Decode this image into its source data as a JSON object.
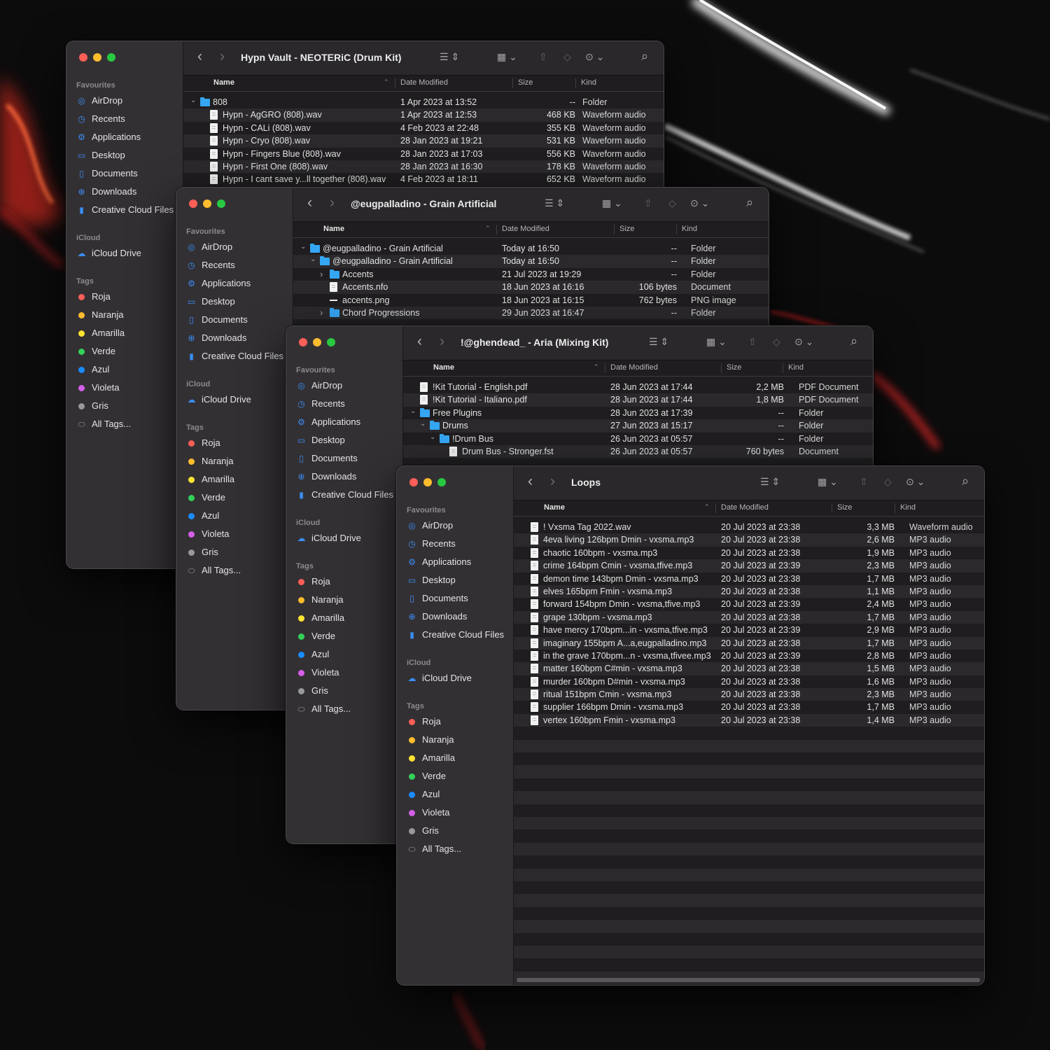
{
  "sidebar": {
    "favourites_title": "Favourites",
    "favourites": [
      {
        "label": "AirDrop",
        "icon": "airdrop-icon"
      },
      {
        "label": "Recents",
        "icon": "clock-icon"
      },
      {
        "label": "Applications",
        "icon": "applications-icon"
      },
      {
        "label": "Desktop",
        "icon": "desktop-icon"
      },
      {
        "label": "Documents",
        "icon": "document-icon"
      },
      {
        "label": "Downloads",
        "icon": "download-icon"
      },
      {
        "label": "Creative Cloud Files",
        "icon": "file-icon"
      }
    ],
    "icloud_title": "iCloud",
    "icloud": [
      {
        "label": "iCloud Drive",
        "icon": "cloud-icon"
      }
    ],
    "tags_title": "Tags",
    "tags": [
      {
        "label": "Roja",
        "color": "#fe5f57"
      },
      {
        "label": "Naranja",
        "color": "#febc2e"
      },
      {
        "label": "Amarilla",
        "color": "#ffe432"
      },
      {
        "label": "Verde",
        "color": "#32d158"
      },
      {
        "label": "Azul",
        "color": "#1a8cff"
      },
      {
        "label": "Violeta",
        "color": "#d45fe8"
      },
      {
        "label": "Gris",
        "color": "#98989d"
      }
    ],
    "all_tags": "All Tags..."
  },
  "columns": {
    "name": "Name",
    "date": "Date Modified",
    "size": "Size",
    "kind": "Kind"
  },
  "windows": [
    {
      "title": "Hypn Vault - NEOTERiC (Drum Kit)",
      "rows": [
        {
          "name": "808",
          "date": "1 Apr 2023 at 13:52",
          "size": "--",
          "kind": "Folder",
          "type": "folder",
          "depth": 0,
          "disclosure": "open"
        },
        {
          "name": "Hypn - AgGRO (808).wav",
          "date": "1 Apr 2023 at 12:53",
          "size": "468 KB",
          "kind": "Waveform audio",
          "type": "file",
          "depth": 1
        },
        {
          "name": "Hypn - CALi (808).wav",
          "date": "4 Feb 2023 at 22:48",
          "size": "355 KB",
          "kind": "Waveform audio",
          "type": "file",
          "depth": 1
        },
        {
          "name": "Hypn - Cryo (808).wav",
          "date": "28 Jan 2023 at 19:21",
          "size": "531 KB",
          "kind": "Waveform audio",
          "type": "file",
          "depth": 1
        },
        {
          "name": "Hypn - Fingers Blue (808).wav",
          "date": "28 Jan 2023 at 17:03",
          "size": "556 KB",
          "kind": "Waveform audio",
          "type": "file",
          "depth": 1
        },
        {
          "name": "Hypn - First One (808).wav",
          "date": "28 Jan 2023 at 16:30",
          "size": "178 KB",
          "kind": "Waveform audio",
          "type": "file",
          "depth": 1
        },
        {
          "name": "Hypn - I cant save y...ll together (808).wav",
          "date": "4 Feb 2023 at 18:11",
          "size": "652 KB",
          "kind": "Waveform audio",
          "type": "file",
          "depth": 1
        }
      ]
    },
    {
      "title": "@eugpalladino - Grain Artificial",
      "rows": [
        {
          "name": "@eugpalladino - Grain Artificial",
          "date": "Today at 16:50",
          "size": "--",
          "kind": "Folder",
          "type": "folder",
          "depth": 0,
          "disclosure": "open"
        },
        {
          "name": "@eugpalladino - Grain Artificial",
          "date": "Today at 16:50",
          "size": "--",
          "kind": "Folder",
          "type": "folder",
          "depth": 1,
          "disclosure": "open"
        },
        {
          "name": "Accents",
          "date": "21 Jul 2023 at 19:29",
          "size": "--",
          "kind": "Folder",
          "type": "folder",
          "depth": 2,
          "disclosure": "closed"
        },
        {
          "name": "Accents.nfo",
          "date": "18 Jun 2023 at 16:16",
          "size": "106 bytes",
          "kind": "Document",
          "type": "file",
          "depth": 2
        },
        {
          "name": "accents.png",
          "date": "18 Jun 2023 at 16:15",
          "size": "762 bytes",
          "kind": "PNG image",
          "type": "image",
          "depth": 2
        },
        {
          "name": "Chord Progressions",
          "date": "29 Jun 2023 at 16:47",
          "size": "--",
          "kind": "Folder",
          "type": "folder",
          "depth": 2,
          "disclosure": "closed"
        }
      ]
    },
    {
      "title": "!@ghendead_ - Aria (Mixing Kit)",
      "rows": [
        {
          "name": "!Kit Tutorial - English.pdf",
          "date": "28 Jun 2023 at 17:44",
          "size": "2,2 MB",
          "kind": "PDF Document",
          "type": "file",
          "depth": 0
        },
        {
          "name": "!Kit Tutorial - Italiano.pdf",
          "date": "28 Jun 2023 at 17:44",
          "size": "1,8 MB",
          "kind": "PDF Document",
          "type": "file",
          "depth": 0
        },
        {
          "name": "Free Plugins",
          "date": "28 Jun 2023 at 17:39",
          "size": "--",
          "kind": "Folder",
          "type": "folder",
          "depth": 0,
          "disclosure": "open"
        },
        {
          "name": "Drums",
          "date": "27 Jun 2023 at 15:17",
          "size": "--",
          "kind": "Folder",
          "type": "folder",
          "depth": 1,
          "disclosure": "open"
        },
        {
          "name": "!Drum Bus",
          "date": "26 Jun 2023 at 05:57",
          "size": "--",
          "kind": "Folder",
          "type": "folder",
          "depth": 2,
          "disclosure": "open"
        },
        {
          "name": "Drum Bus - Stronger.fst",
          "date": "26 Jun 2023 at 05:57",
          "size": "760 bytes",
          "kind": "Document",
          "type": "file",
          "depth": 3
        }
      ]
    },
    {
      "title": "Loops",
      "rows": [
        {
          "name": "! Vxsma Tag 2022.wav",
          "date": "20 Jul 2023 at 23:38",
          "size": "3,3 MB",
          "kind": "Waveform audio",
          "type": "file",
          "depth": 0
        },
        {
          "name": "4eva living 126bpm Dmin - vxsma.mp3",
          "date": "20 Jul 2023 at 23:38",
          "size": "2,6 MB",
          "kind": "MP3 audio",
          "type": "file",
          "depth": 0
        },
        {
          "name": "chaotic 160bpm - vxsma.mp3",
          "date": "20 Jul 2023 at 23:38",
          "size": "1,9 MB",
          "kind": "MP3 audio",
          "type": "file",
          "depth": 0
        },
        {
          "name": "crime 164bpm Cmin - vxsma,tfive.mp3",
          "date": "20 Jul 2023 at 23:39",
          "size": "2,3 MB",
          "kind": "MP3 audio",
          "type": "file",
          "depth": 0
        },
        {
          "name": "demon time 143bpm Dmin - vxsma.mp3",
          "date": "20 Jul 2023 at 23:38",
          "size": "1,7 MB",
          "kind": "MP3 audio",
          "type": "file",
          "depth": 0
        },
        {
          "name": "elves 165bpm Fmin - vxsma.mp3",
          "date": "20 Jul 2023 at 23:38",
          "size": "1,1 MB",
          "kind": "MP3 audio",
          "type": "file",
          "depth": 0
        },
        {
          "name": "forward 154bpm Dmin - vxsma,tfive.mp3",
          "date": "20 Jul 2023 at 23:39",
          "size": "2,4 MB",
          "kind": "MP3 audio",
          "type": "file",
          "depth": 0
        },
        {
          "name": "grape 130bpm - vxsma.mp3",
          "date": "20 Jul 2023 at 23:38",
          "size": "1,7 MB",
          "kind": "MP3 audio",
          "type": "file",
          "depth": 0
        },
        {
          "name": "have mercy 170bpm...in - vxsma,tfive.mp3",
          "date": "20 Jul 2023 at 23:39",
          "size": "2,9 MB",
          "kind": "MP3 audio",
          "type": "file",
          "depth": 0
        },
        {
          "name": "imaginary 155bpm A...a,eugpalladino.mp3",
          "date": "20 Jul 2023 at 23:38",
          "size": "1,7 MB",
          "kind": "MP3 audio",
          "type": "file",
          "depth": 0
        },
        {
          "name": "in the grave 170bpm...n - vxsma,tfivee.mp3",
          "date": "20 Jul 2023 at 23:39",
          "size": "2,8 MB",
          "kind": "MP3 audio",
          "type": "file",
          "depth": 0
        },
        {
          "name": "matter 160bpm C#min - vxsma.mp3",
          "date": "20 Jul 2023 at 23:38",
          "size": "1,5 MB",
          "kind": "MP3 audio",
          "type": "file",
          "depth": 0
        },
        {
          "name": "murder 160bpm D#min - vxsma.mp3",
          "date": "20 Jul 2023 at 23:38",
          "size": "1,6 MB",
          "kind": "MP3 audio",
          "type": "file",
          "depth": 0
        },
        {
          "name": "ritual 151bpm Cmin - vxsma.mp3",
          "date": "20 Jul 2023 at 23:38",
          "size": "2,3 MB",
          "kind": "MP3 audio",
          "type": "file",
          "depth": 0
        },
        {
          "name": "supplier 166bpm Dmin - vxsma.mp3",
          "date": "20 Jul 2023 at 23:38",
          "size": "1,7 MB",
          "kind": "MP3 audio",
          "type": "file",
          "depth": 0
        },
        {
          "name": "vertex 160bpm Fmin - vxsma.mp3",
          "date": "20 Jul 2023 at 23:38",
          "size": "1,4 MB",
          "kind": "MP3 audio",
          "type": "file",
          "depth": 0
        }
      ]
    }
  ]
}
